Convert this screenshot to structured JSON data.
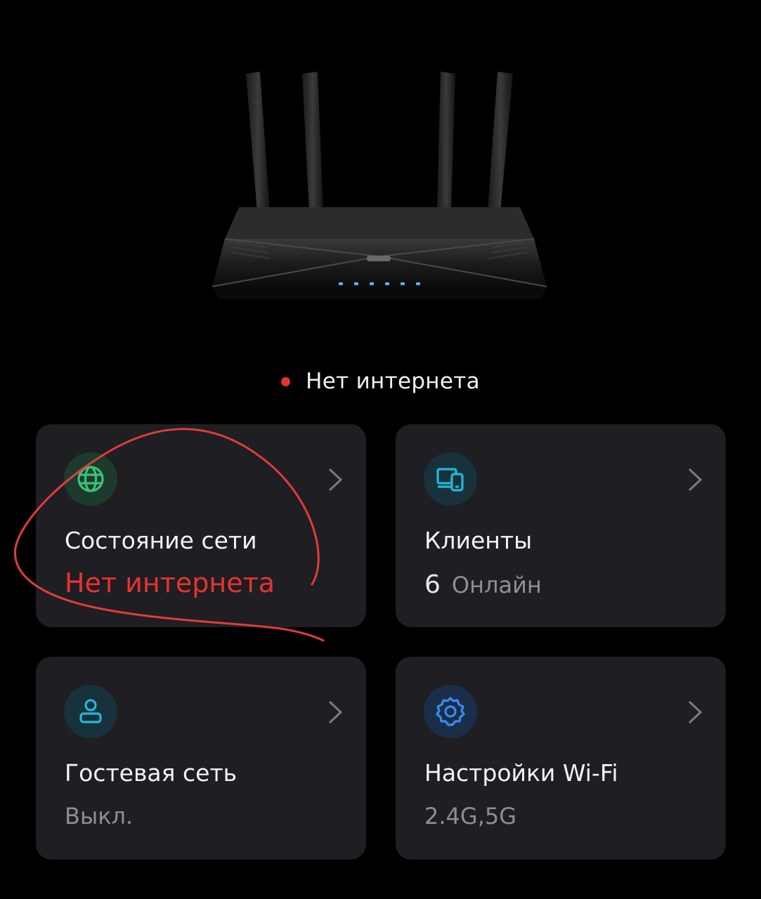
{
  "header": {
    "status_text": "Нет интернета",
    "status_color": "#e8332e"
  },
  "cards": {
    "network": {
      "title": "Состояние сети",
      "subtitle": "Нет интернета",
      "subtitle_color": "#e8332e",
      "icon": "globe-icon",
      "icon_color": "#3ac27a"
    },
    "clients": {
      "title": "Клиенты",
      "count": "6",
      "subtitle": "Онлайн",
      "icon": "devices-icon",
      "icon_color": "#27b6d8"
    },
    "guest": {
      "title": "Гостевая сеть",
      "subtitle": "Выкл.",
      "icon": "person-icon",
      "icon_color": "#27b6d8"
    },
    "wifi": {
      "title": "Настройки Wi-Fi",
      "subtitle": "2.4G,5G",
      "icon": "gear-icon",
      "icon_color": "#3a8cf0"
    }
  },
  "colors": {
    "background": "#000000",
    "card": "#1e1e23",
    "annotation": "#e23b3b"
  }
}
